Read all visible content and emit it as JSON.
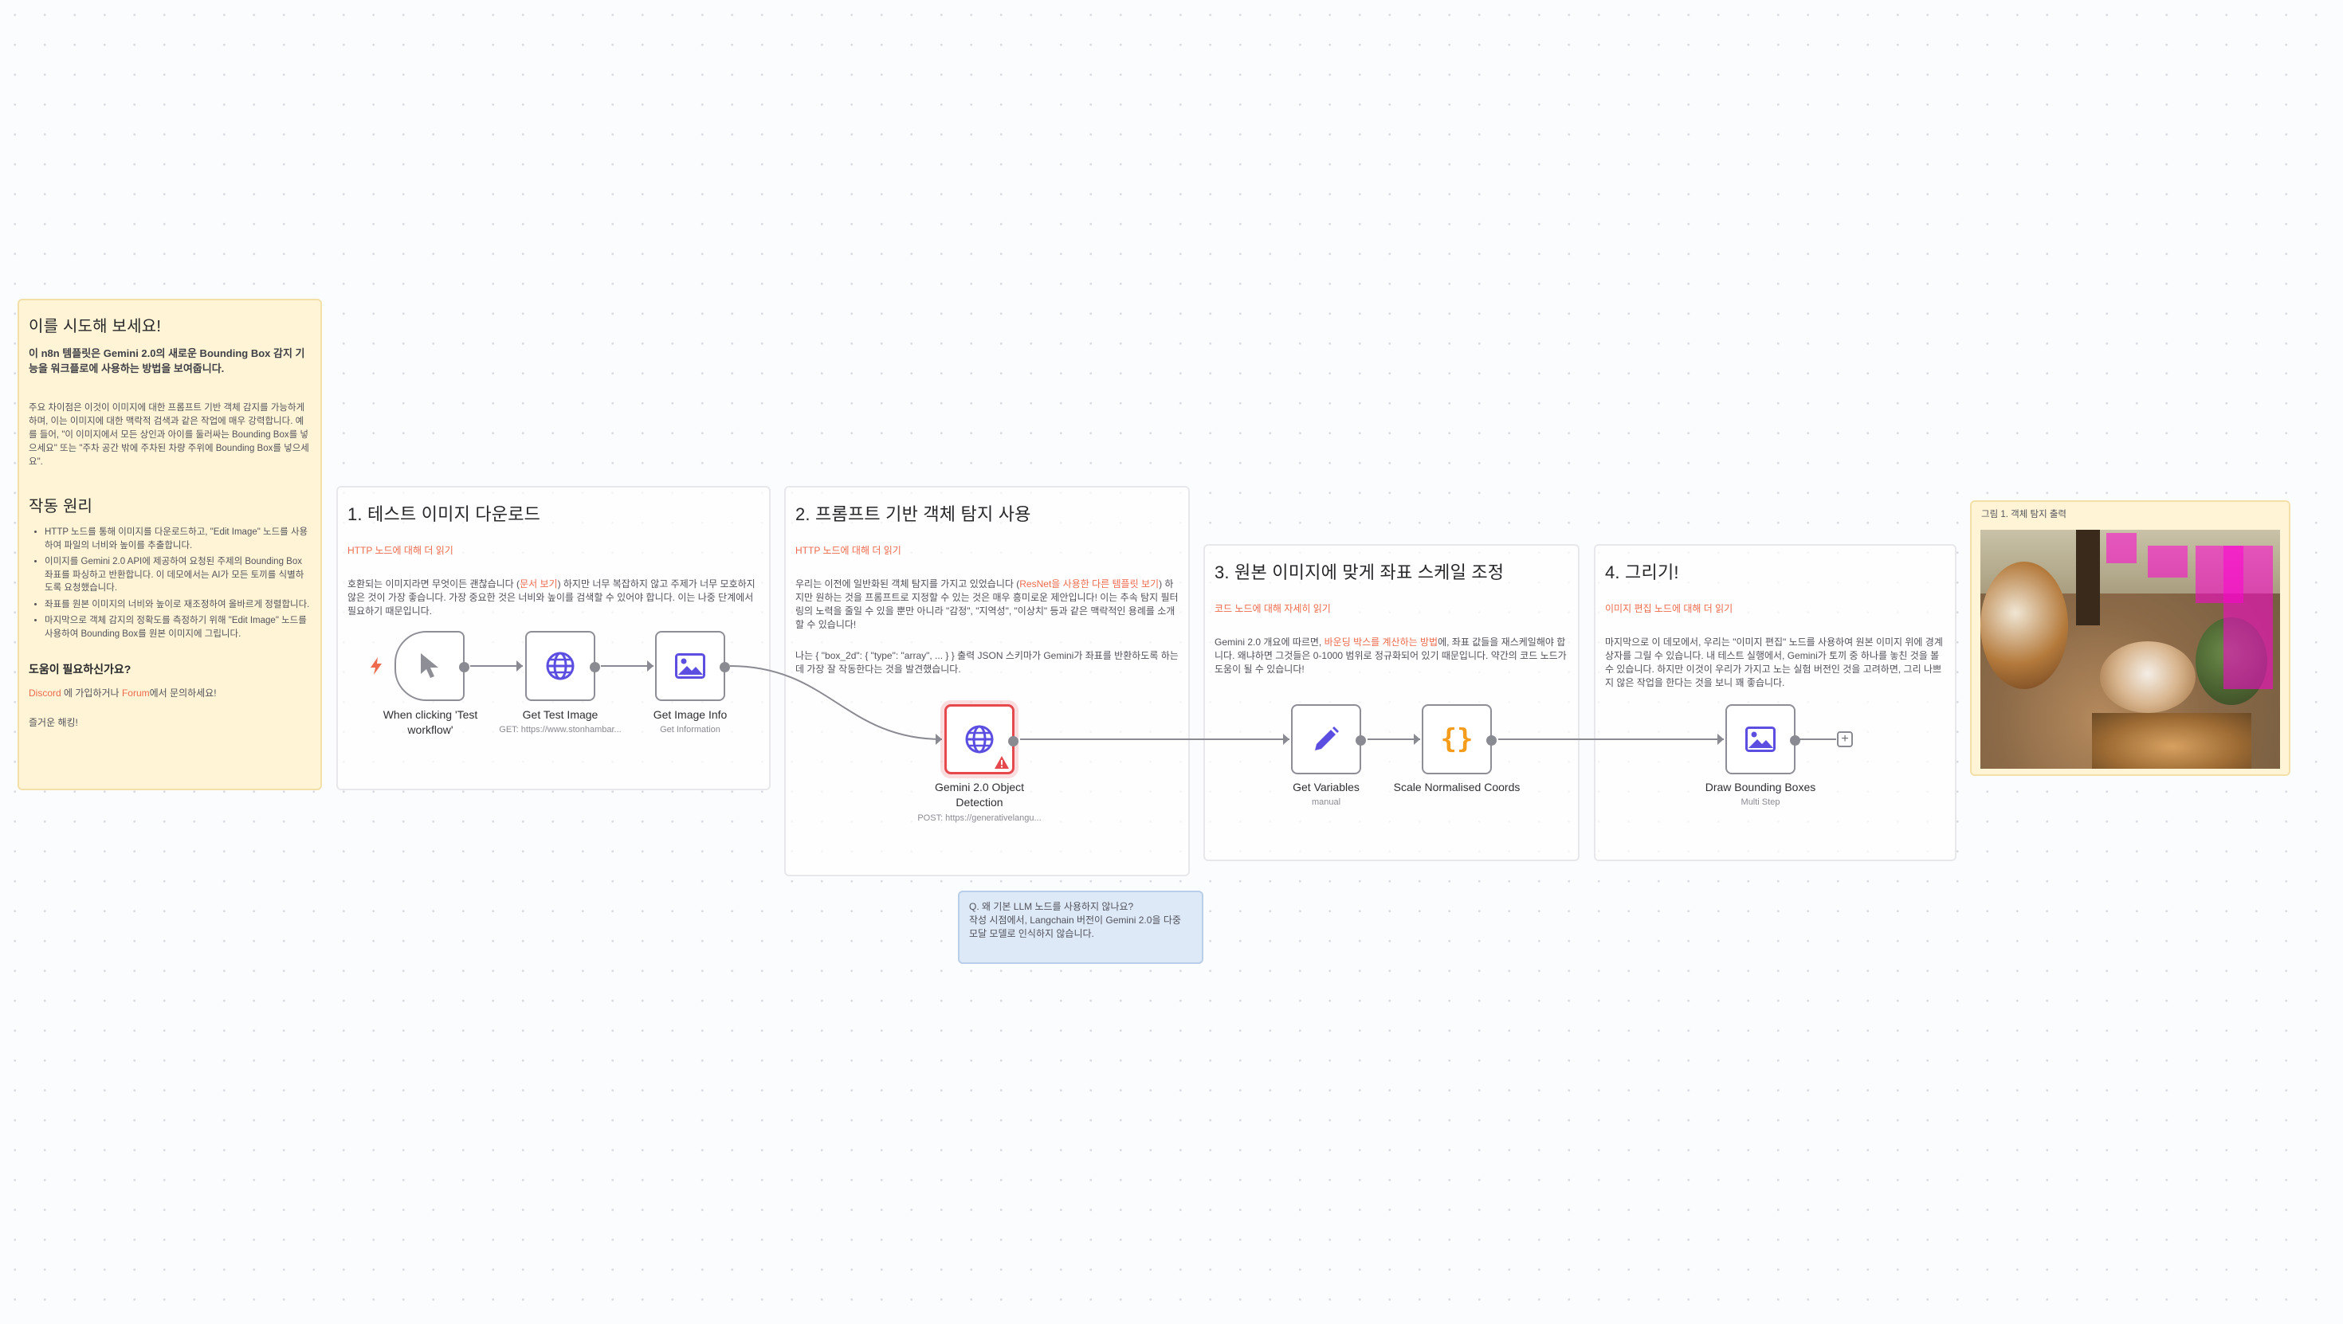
{
  "intro": {
    "title": "이를 시도해 보세요!",
    "lead": "이 n8n 템플릿은 Gemini 2.0의 새로운 Bounding Box 감지 기능을 워크플로에 사용하는 방법을 보여줍니다.",
    "body": "주요 차이점은 이것이 이미지에 대한 프롬프트 기반 객체 감지를 가능하게 하며, 이는 이미지에 대한 맥락적 검색과 같은 작업에 매우 강력합니다. 예를 들어, \"이 이미지에서 모든 상인과 아이를 둘러싸는 Bounding Box를 넣으세요\" 또는 \"주차 공간 밖에 주차된 차량 주위에 Bounding Box를 넣으세요\".",
    "how_title": "작동 원리",
    "how_items": [
      "HTTP 노드를 통해 이미지를 다운로드하고, \"Edit Image\" 노드를 사용하여 파일의 너비와 높이를 추출합니다.",
      "이미지를 Gemini 2.0 API에 제공하여 요청된 주제의 Bounding Box 좌표를 파싱하고 반환합니다. 이 데모에서는 AI가 모든 토끼를 식별하도록 요청했습니다.",
      "좌표를 원본 이미지의 너비와 높이로 재조정하여 올바르게 정렬합니다.",
      "마지막으로 객체 감지의 정확도를 측정하기 위해 \"Edit Image\" 노드를 사용하여 Bounding Box를 원본 이미지에 그립니다."
    ],
    "help_title": "도움이 필요하신가요?",
    "help_discord": "Discord",
    "help_mid": " 에 가입하거나 ",
    "help_forum": "Forum",
    "help_end": "에서 문의하세요!",
    "closing": "즐거운 해킹!"
  },
  "sections": {
    "s1": {
      "title": "1. 테스트 이미지 다운로드",
      "link": "HTTP 노드에 대해 더 읽기",
      "body_a": "호환되는 이미지라면 무엇이든 괜찮습니다 (",
      "body_link": "문서 보기",
      "body_b": ") 하지만 너무 복잡하지 않고 주제가 너무 모호하지 않은 것이 가장 좋습니다. 가장 중요한 것은 너비와 높이를 검색할 수 있어야 합니다. 이는 나중 단계에서 필요하기 때문입니다."
    },
    "s2": {
      "title": "2. 프롬프트 기반 객체 탐지 사용",
      "link": "HTTP 노드에 대해 더 읽기",
      "body_a": "우리는 이전에 일반화된 객체 탐지를 가지고 있었습니다 (",
      "body_link": "ResNet을 사용한 다른 템플릿 보기",
      "body_b": ") 하지만 원하는 것을 프롬프트로 지정할 수 있는 것은 매우 흥미로운 제안입니다! 이는 추속 탐지 필터링의 노력을 줄일 수 있을 뿐만 아니라 \"감정\", \"지역성\", \"이상치\" 등과 같은 맥락적인 용례를 소개할 수 있습니다!",
      "body_c": "나는 { \"box_2d\": { \"type\": \"array\", ... } } 출력 JSON 스키마가 Gemini가 좌표를 반환하도록 하는 데 가장 잘 작동한다는 것을 발견했습니다."
    },
    "s3": {
      "title": "3. 원본 이미지에 맞게 좌표 스케일 조정",
      "link": "코드 노드에 대해 자세히 읽기",
      "body_a": "Gemini 2.0 개요에 따르면, ",
      "body_link": "바운딩 박스를 계산하는 방법",
      "body_b": "에, 좌표 값들을 재스케일해야 합니다. 왜냐하면 그것들은 0-1000 범위로 정규화되어 있기 때문입니다. 약간의 코드 노드가 도움이 될 수 있습니다!"
    },
    "s4": {
      "title": "4. 그리기!",
      "link": "이미지 편집 노드에 대해 더 읽기",
      "body": "마지막으로 이 데모에서, 우리는 \"이미지 편집\" 노드를 사용하여 원본 이미지 위에 경계 상자를 그릴 수 있습니다. 내 테스트 실행에서, Gemini가 토끼 중 하나를 놓친 것을 볼 수 있습니다. 하지만 이것이 우리가 가지고 노는 실험 버전인 것을 고려하면, 그리 나쁘지 않은 작업을 한다는 것을 보니 꽤 좋습니다."
    }
  },
  "faq": {
    "q": "Q. 왜 기본 LLM 노드를 사용하지 않나요?",
    "a": "작성 시점에서, Langchain 버전이 Gemini 2.0을 다중 모달 모델로 인식하지 않습니다."
  },
  "output": {
    "caption": "그림 1. 객체 탐지 출력"
  },
  "nodes": {
    "trigger": {
      "label": "When clicking 'Test workflow'",
      "icon": "cursor-icon"
    },
    "get_image": {
      "label": "Get Test Image",
      "sub": "GET: https://www.stonhambar...",
      "icon": "globe-icon"
    },
    "image_info": {
      "label": "Get Image Info",
      "sub": "Get Information",
      "icon": "image-icon"
    },
    "gemini": {
      "label": "Gemini 2.0 Object Detection",
      "sub": "POST: https://generativelangu...",
      "icon": "globe-icon",
      "warning": "warning-icon"
    },
    "variables": {
      "label": "Get Variables",
      "sub": "manual",
      "icon": "pencil-icon"
    },
    "scale": {
      "label": "Scale Normalised Coords",
      "icon": "code-braces-icon"
    },
    "draw": {
      "label": "Draw Bounding Boxes",
      "sub": "Multi Step",
      "icon": "image-icon"
    }
  },
  "colors": {
    "accent": "#ee6b4d",
    "node_icon": "#5b4ee0",
    "code_icon": "#f59c1a",
    "error": "#e5484d",
    "box": "#ff00d2"
  }
}
